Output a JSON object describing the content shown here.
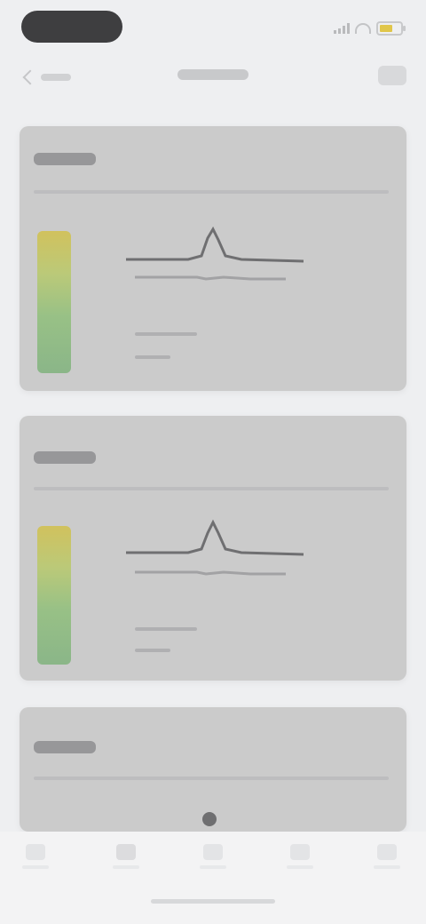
{
  "status_bar": {
    "pill_icon": "status-pill",
    "signal_icon": "signal-icon",
    "wifi_icon": "wifi-icon",
    "battery_icon": "battery-icon",
    "battery_color": "#e0c64a"
  },
  "nav": {
    "back_icon": "chevron-left-icon",
    "title": "",
    "action_icon": "menu-icon"
  },
  "cards": [
    {
      "title": "",
      "level_fraction": 1.0,
      "chart_icon": "spike-chart-icon"
    },
    {
      "title": "",
      "level_fraction": 1.0,
      "chart_icon": "spike-chart-icon"
    },
    {
      "title": "",
      "level_fraction": 0.0,
      "chart_icon": "spike-chart-icon"
    }
  ],
  "tabs": [
    {
      "icon": "tab-icon-1",
      "label": ""
    },
    {
      "icon": "tab-icon-2",
      "label": ""
    },
    {
      "icon": "tab-icon-3",
      "label": ""
    },
    {
      "icon": "tab-icon-4",
      "label": ""
    },
    {
      "icon": "tab-icon-5",
      "label": ""
    }
  ],
  "colors": {
    "background": "#eeeff1",
    "card": "#cbcbcb",
    "level_top": "#d2c04a",
    "level_bottom": "#7fb27c"
  }
}
